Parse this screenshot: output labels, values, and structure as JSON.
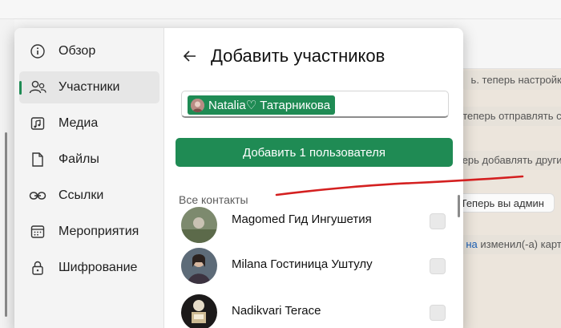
{
  "background": {
    "messages": [
      {
        "text": "ь. теперь настройки"
      },
      {
        "text": "ь теперь отправлять со"
      },
      {
        "text": "ерь добавлять других"
      },
      {
        "text": "Теперь вы админ"
      },
      {
        "text_link": "на",
        "text": " изменил(-а) карти"
      }
    ]
  },
  "sidebar": {
    "items": [
      {
        "label": "Обзор",
        "icon": "info-icon"
      },
      {
        "label": "Участники",
        "icon": "people-icon"
      },
      {
        "label": "Медиа",
        "icon": "media-icon"
      },
      {
        "label": "Файлы",
        "icon": "file-icon"
      },
      {
        "label": "Ссылки",
        "icon": "link-icon"
      },
      {
        "label": "Мероприятия",
        "icon": "calendar-icon"
      },
      {
        "label": "Шифрование",
        "icon": "lock-icon"
      }
    ],
    "active_index": 1
  },
  "panel": {
    "title": "Добавить участников",
    "selected_chip": "Natalia♡ Татарникова",
    "add_button": "Добавить 1 пользователя",
    "section_label": "Все контакты",
    "contacts": [
      {
        "name": "Magomed Гид Ингушетия"
      },
      {
        "name": "Milana Гостиница Уштулу"
      },
      {
        "name": "Nadikvari Terace"
      }
    ]
  },
  "colors": {
    "accent": "#1f8b54",
    "annotation": "#d42020"
  }
}
